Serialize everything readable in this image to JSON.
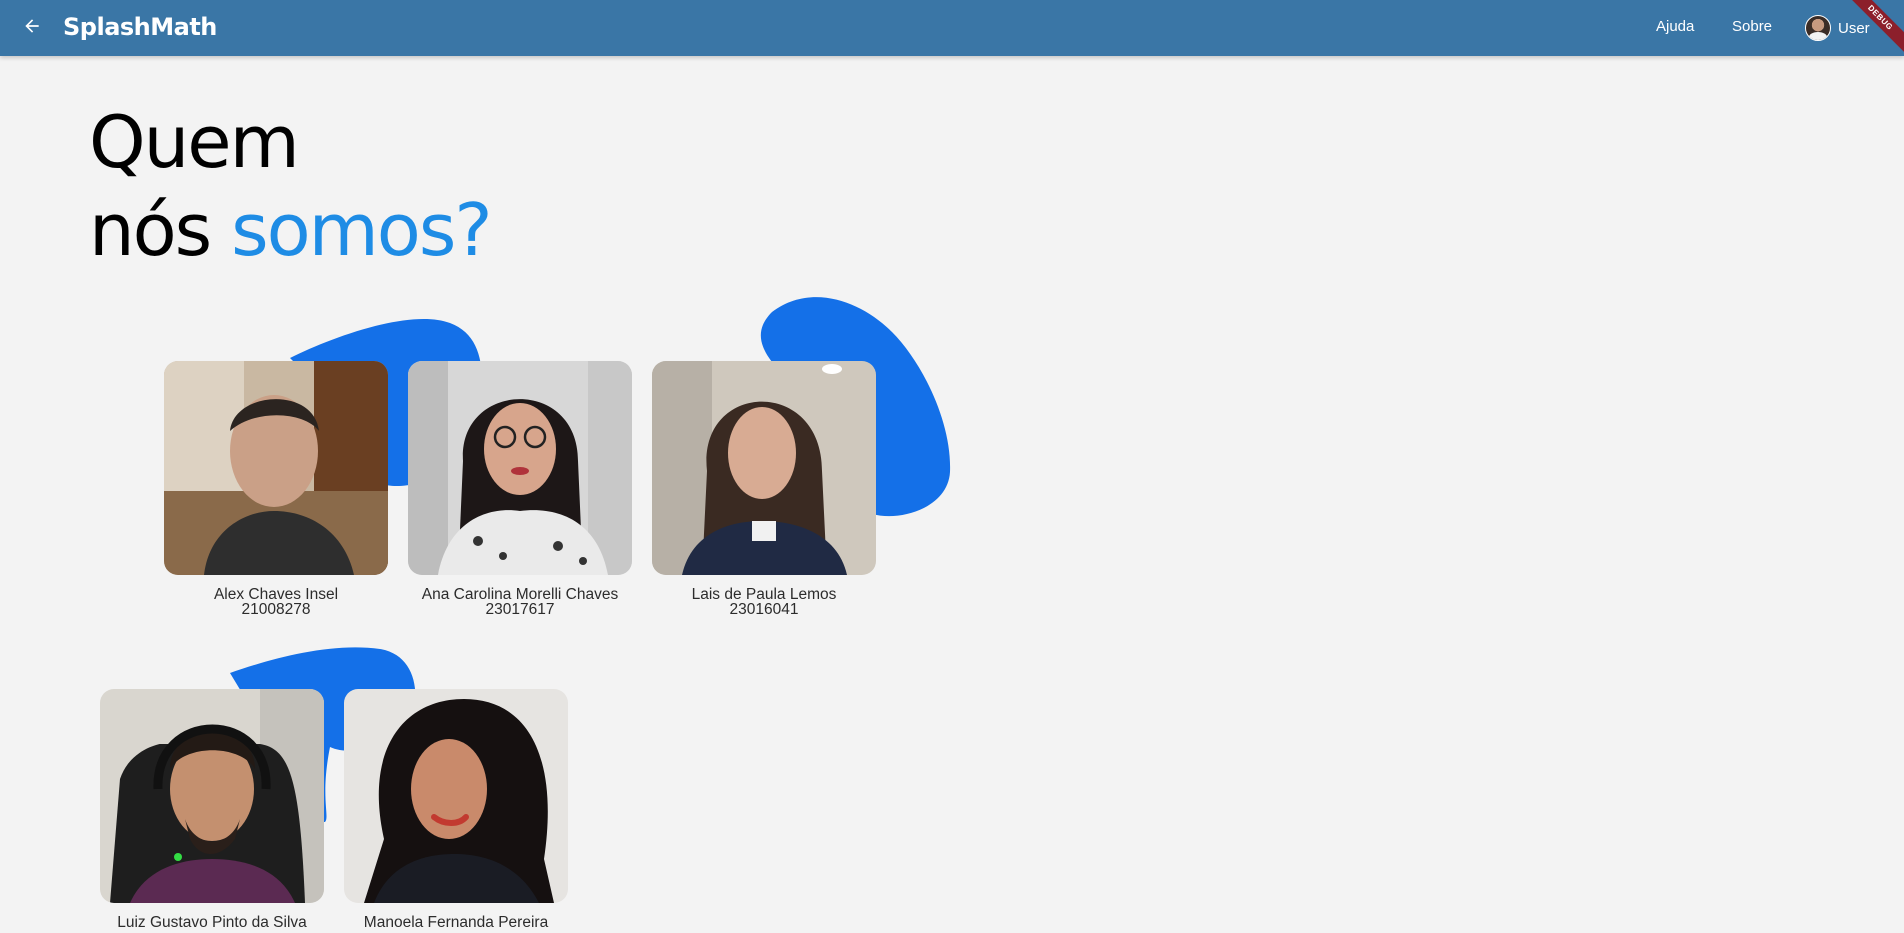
{
  "appbar": {
    "title": "SplashMath",
    "back_icon": "arrow-back-icon",
    "nav": [
      {
        "label": "Ajuda"
      },
      {
        "label": "Sobre"
      }
    ],
    "user": {
      "label": "User",
      "avatar_icon": "user-avatar"
    },
    "debug_banner": "DEBUG",
    "color": "#3a76a6"
  },
  "hero": {
    "line1": "Quem",
    "line2_plain": "nós",
    "line2_accent": "somos?",
    "accent_color": "#1e8ce5"
  },
  "blob_color": "#1470e8",
  "members": [
    {
      "name": "Alex Chaves Insel",
      "id": "21008278"
    },
    {
      "name": "Ana Carolina Morelli Chaves",
      "id": "23017617"
    },
    {
      "name": "Lais de Paula Lemos",
      "id": "23016041"
    },
    {
      "name": "Luiz Gustavo Pinto da Silva",
      "id": ""
    },
    {
      "name": "Manoela Fernanda Pereira",
      "id": ""
    }
  ]
}
